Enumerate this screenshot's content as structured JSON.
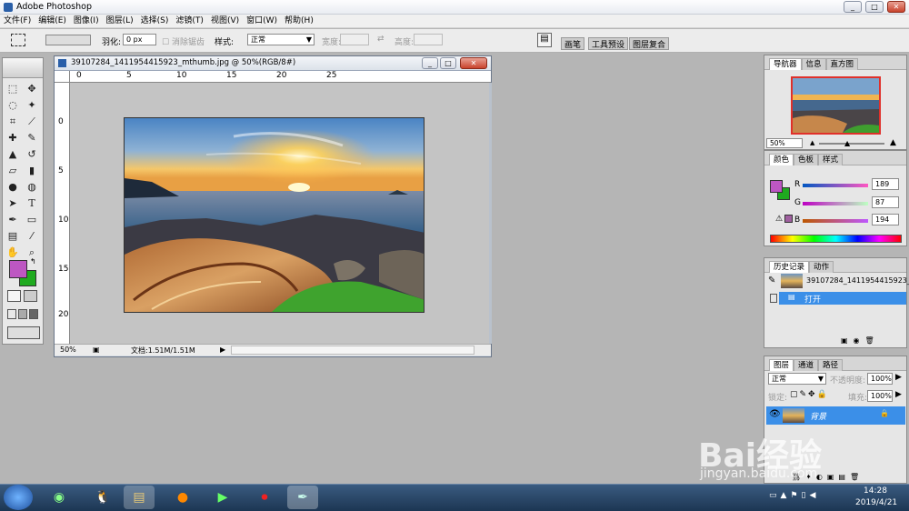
{
  "window": {
    "title": "Adobe Photoshop",
    "min": "_",
    "max": "□",
    "close": "✕"
  },
  "menu": [
    "文件(F)",
    "编辑(E)",
    "图像(I)",
    "图层(L)",
    "选择(S)",
    "滤镜(T)",
    "视图(V)",
    "窗口(W)",
    "帮助(H)"
  ],
  "options": {
    "feather_label": "羽化:",
    "feather_value": "0 px",
    "antialias_label": "消除锯齿",
    "style_label": "样式:",
    "style_value": "正常",
    "width_label": "宽度:",
    "height_label": "高度:",
    "tabs": [
      "画笔",
      "工具预设",
      "图层复合"
    ]
  },
  "document": {
    "title": "39107284_1411954415923_mthumb.jpg @ 50%(RGB/8#)",
    "zoom": "50%",
    "doc_size": "文档:1.51M/1.51M",
    "ruler_h": [
      "0",
      "5",
      "10",
      "15",
      "20",
      "25"
    ],
    "ruler_v": [
      "0",
      "5",
      "10",
      "15",
      "20"
    ]
  },
  "navigator": {
    "tabs": [
      "导航器",
      "信息",
      "直方图"
    ],
    "zoom": "50%"
  },
  "color": {
    "tabs": [
      "颜色",
      "色板",
      "样式"
    ],
    "r_label": "R",
    "r_value": "189",
    "g_label": "G",
    "g_value": "87",
    "b_label": "B",
    "b_value": "194",
    "fg_color": "#bd57c2",
    "bg_color": "#1faa1f"
  },
  "history": {
    "tabs": [
      "历史记录",
      "动作"
    ],
    "snapshot": "39107284_1411954415923_...",
    "items": [
      {
        "label": "打开"
      }
    ]
  },
  "layers": {
    "tabs": [
      "图层",
      "通道",
      "路径"
    ],
    "blend_mode": "正常",
    "opacity_label": "不透明度:",
    "opacity_value": "100%",
    "lock_label": "锁定:",
    "fill_label": "填充:",
    "fill_value": "100%",
    "items": [
      {
        "name": "背景"
      }
    ]
  },
  "taskbar": {
    "time": "14:28",
    "date": "2019/4/21"
  },
  "watermark": {
    "brand": "Bai经验",
    "url": "jingyan.baidu.com"
  }
}
